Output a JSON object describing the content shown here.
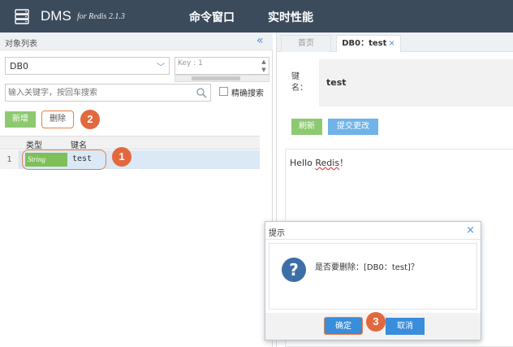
{
  "header": {
    "app_name": "DMS",
    "app_subtitle": "for Redis 2.1.3",
    "nav": [
      "命令窗口",
      "实时性能"
    ]
  },
  "left": {
    "panel_title": "对象列表",
    "db_select": "DB0",
    "key_box_value": "Key : 1",
    "search_placeholder": "输入关键字，按回车搜索",
    "exact_search_label": "精确搜索",
    "add_label": "新增",
    "delete_label": "删除",
    "columns": [
      "类型",
      "键名"
    ],
    "rows": [
      {
        "num": "1",
        "type": "String",
        "key": "test"
      }
    ]
  },
  "right": {
    "tabs": {
      "home": "首页",
      "active": "DB0：test",
      "close": "×"
    },
    "key_label": "键名：",
    "key_value": "test",
    "refresh_label": "刷新",
    "submit_label": "提交更改",
    "editor_before": "Hello ",
    "editor_word": "Redis",
    "editor_after": "！"
  },
  "dialog": {
    "title": "提示",
    "close": "×",
    "message": "是否要删除：[DB0：test]？",
    "ok_label": "确定",
    "cancel_label": "取消"
  },
  "badges": [
    "1",
    "2",
    "3"
  ],
  "colors": {
    "topbar": "#3c4b5c",
    "green": "#8dc970",
    "blue": "#3a8ddb",
    "annotation": "#e2683e"
  }
}
